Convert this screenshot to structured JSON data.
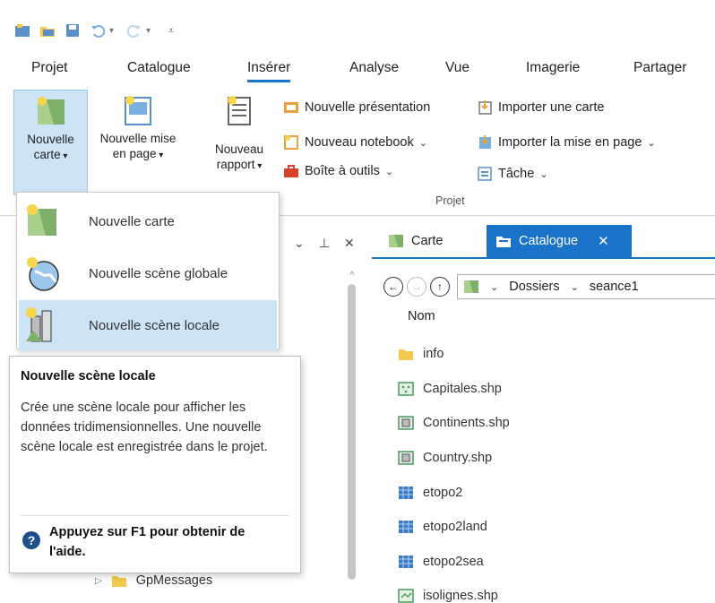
{
  "ribbon_tabs": [
    "Projet",
    "Catalogue",
    "Insérer",
    "Analyse",
    "Vue",
    "Imagerie",
    "Partager"
  ],
  "active_tab": "Insérer",
  "ribbon": {
    "new_map": {
      "line1": "Nouvelle",
      "line2": "carte"
    },
    "new_layout": {
      "line1": "Nouvelle mise",
      "line2": "en page"
    },
    "new_report": {
      "line1": "Nouveau",
      "line2": "rapport"
    },
    "new_presentation": "Nouvelle présentation",
    "new_notebook": "Nouveau notebook",
    "toolbox": "Boîte à outils",
    "import_map": "Importer une carte",
    "import_layout": "Importer la mise en page",
    "task": "Tâche",
    "group_label": "Projet"
  },
  "dropdown": {
    "items": [
      "Nouvelle carte",
      "Nouvelle scène globale",
      "Nouvelle scène locale"
    ],
    "hovered": "Nouvelle scène locale"
  },
  "tooltip": {
    "title": "Nouvelle scène locale",
    "body": "Crée une scène locale pour afficher les données tridimensionnelles. Une nouvelle scène locale est enregistrée dans le projet.",
    "help": "Appuyez sur F1 pour obtenir de l'aide."
  },
  "left_pane": {
    "tree_item": "GpMessages"
  },
  "doc_tabs": {
    "carte": "Carte",
    "catalogue": "Catalogue"
  },
  "catalog": {
    "breadcrumb": [
      "Dossiers",
      "seance1"
    ],
    "column_header": "Nom",
    "files": [
      {
        "name": "info",
        "type": "folder"
      },
      {
        "name": "Capitales.shp",
        "type": "point"
      },
      {
        "name": "Continents.shp",
        "type": "polygon"
      },
      {
        "name": "Country.shp",
        "type": "polygon"
      },
      {
        "name": "etopo2",
        "type": "raster"
      },
      {
        "name": "etopo2land",
        "type": "raster"
      },
      {
        "name": "etopo2sea",
        "type": "raster"
      },
      {
        "name": "isolignes.shp",
        "type": "line"
      }
    ]
  },
  "colors": {
    "accent": "#1a73c9",
    "hover": "#cde4f6",
    "folder": "#f2c94c"
  }
}
